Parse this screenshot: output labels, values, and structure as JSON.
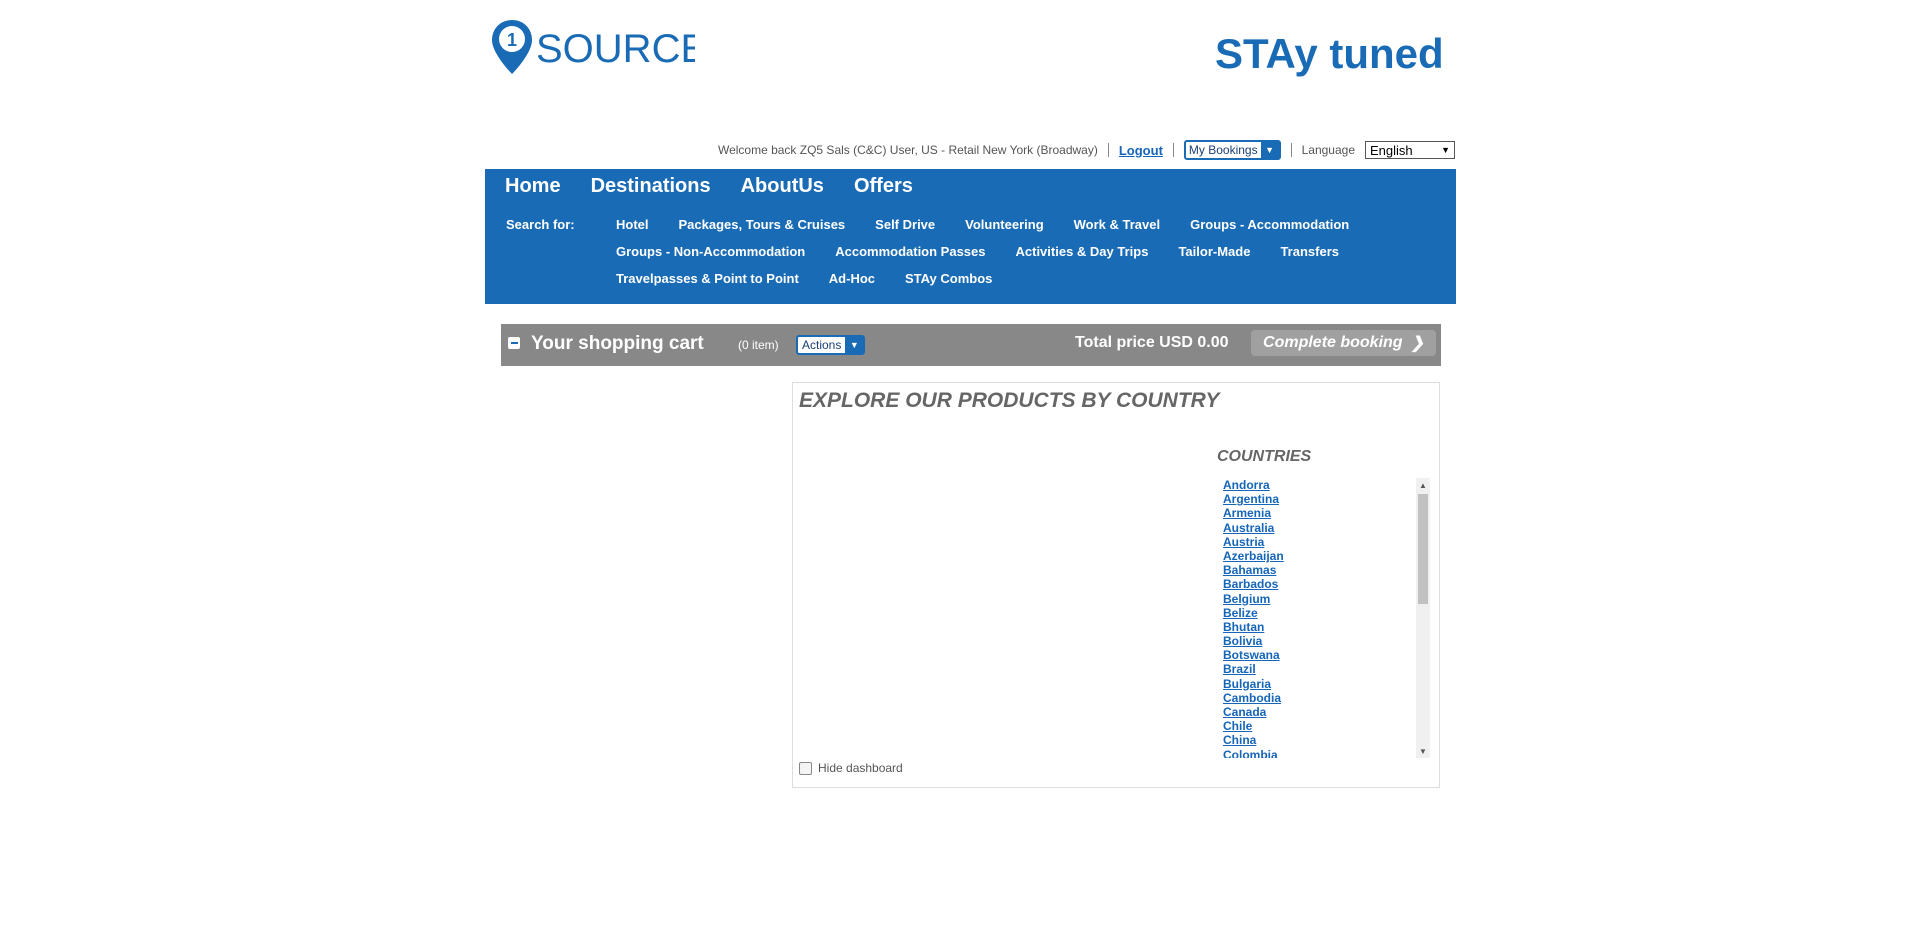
{
  "header": {
    "logo_left_text": "SOURCE",
    "logo_right_text": "STAy tuned"
  },
  "userbar": {
    "welcome": "Welcome back ZQ5 Sals (C&C) User, US - Retail New York (Broadway)",
    "logout": "Logout",
    "my_bookings": "My Bookings",
    "language_label": "Language",
    "language_value": "English"
  },
  "nav": {
    "main": [
      "Home",
      "Destinations",
      "AboutUs",
      "Offers"
    ],
    "search_for": "Search for:",
    "sub_rows": [
      [
        "Hotel",
        "Packages, Tours & Cruises",
        "Self Drive",
        "Volunteering",
        "Work & Travel",
        "Groups - Accommodation"
      ],
      [
        "Groups - Non-Accommodation",
        "Accommodation Passes",
        "Activities & Day Trips",
        "Tailor-Made",
        "Transfers"
      ],
      [
        "Travelpasses & Point to Point",
        "Ad-Hoc",
        "STAy Combos"
      ]
    ]
  },
  "cart": {
    "title": "Your shopping cart",
    "count": "(0 item)",
    "actions": "Actions",
    "total": "Total price USD 0.00",
    "complete": "Complete booking"
  },
  "explore": {
    "title": "EXPLORE OUR PRODUCTS BY COUNTRY",
    "countries_heading": "COUNTRIES",
    "countries": [
      "Andorra",
      "Argentina",
      "Armenia",
      "Australia",
      "Austria",
      "Azerbaijan",
      "Bahamas",
      "Barbados",
      "Belgium",
      "Belize",
      "Bhutan",
      "Bolivia",
      "Botswana",
      "Brazil",
      "Bulgaria",
      "Cambodia",
      "Canada",
      "Chile",
      "China",
      "Colombia"
    ],
    "hide_dashboard": "Hide dashboard"
  },
  "colors": {
    "brand_blue": "#1a6bb5",
    "cart_gray": "#888888"
  }
}
